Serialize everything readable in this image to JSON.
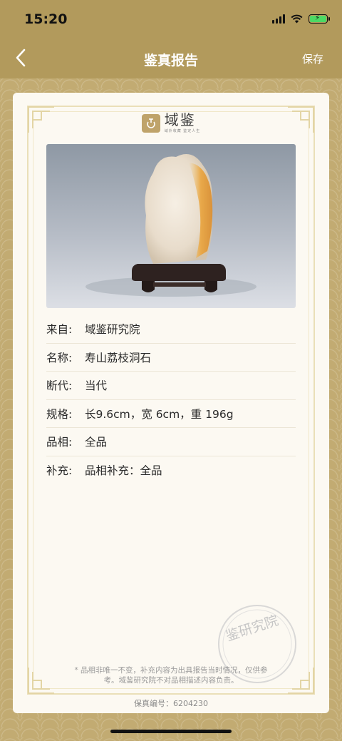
{
  "status_bar": {
    "time": "15:20"
  },
  "nav": {
    "title": "鉴真报告",
    "save_label": "保存"
  },
  "logo": {
    "name": "域鉴",
    "tagline": "域外收藏 鉴定人生"
  },
  "details": [
    {
      "label": "来自:",
      "value": "域鉴研究院"
    },
    {
      "label": "名称:",
      "value": "寿山荔枝洞石"
    },
    {
      "label": "断代:",
      "value": "当代"
    },
    {
      "label": "规格:",
      "value": " 长9.6cm，宽 6cm，重 196g"
    },
    {
      "label": "品相:",
      "value": "全品"
    },
    {
      "label": "补充:",
      "value": "品相补充：全品"
    }
  ],
  "seal": {
    "text": "鉴研究院"
  },
  "note": {
    "line1": "* 品相非唯一不变，补充内容为出具报告当时情况，仅供参",
    "line2": "考。域鉴研究院不对品相描述内容负责。"
  },
  "serial": "保真编号：6204230",
  "colors": {
    "brand": "#b29a5c",
    "card": "#fcf9f2",
    "frame": "#eadfb8"
  }
}
